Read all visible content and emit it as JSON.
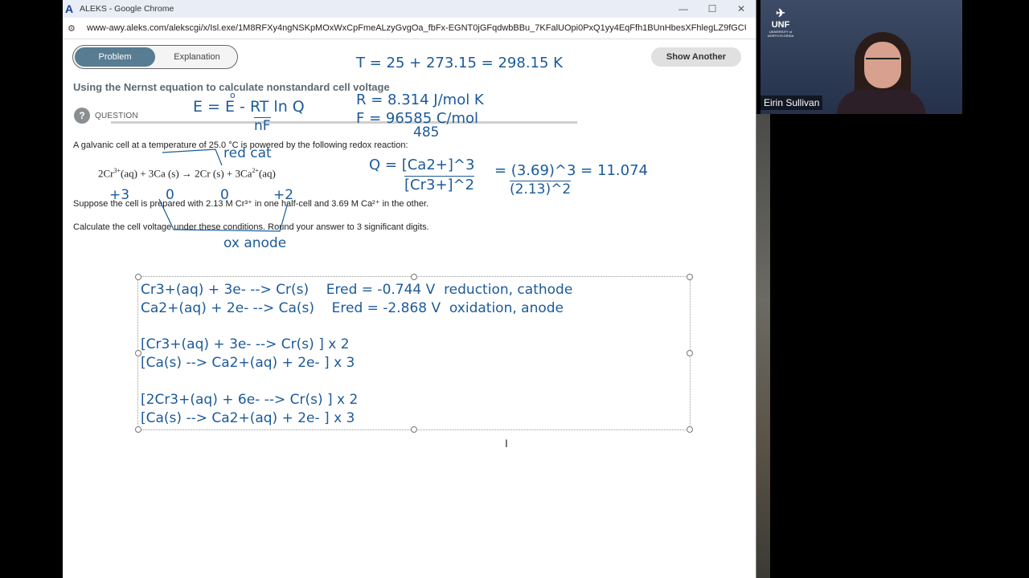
{
  "window": {
    "title": "ALEKS - Google Chrome",
    "url": "www-awy.aleks.com/alekscgi/x/Isl.exe/1M8RFXy4ngNSKpMOxWxCpFmeALzyGvgOa_fbFx-EGNT0jGFqdwbBBu_7KFalUOpi0PxQ1yy4EqFfh1BUnHbesXFhlegLZ9fGCUzCsl..."
  },
  "tabs": {
    "problem": "Problem",
    "explanation": "Explanation"
  },
  "show_another": "Show Another",
  "heading": "Using the Nernst equation to calculate nonstandard cell voltage",
  "question_label": "QUESTION",
  "problem": {
    "intro": "A galvanic cell at a temperature of 25.0 °C is powered by the following redox reaction:",
    "reaction": {
      "t1": "2Cr",
      "s1": "3+",
      "t2": "(aq) + 3Ca (s) → 2Cr (s) + 3Ca",
      "s2": "2+",
      "t3": "(aq)"
    },
    "suppose": "Suppose the cell is prepared with 2.13 M Cr³⁺ in one half-cell and 3.69 M Ca²⁺ in the other.",
    "calculate": "Calculate the cell voltage under these conditions. Round your answer to 3 significant digits."
  },
  "annotations": {
    "temp": "T = 25 + 273.15 = 298.15 K",
    "nernst_left": "E = E - RT ln Q",
    "nernst_nf": "nF",
    "deg": "o",
    "R": "R = 8.314 J/mol K",
    "F": "F = 96585 C/mol",
    "F_correction": "485",
    "red_cat": "red cat",
    "ox_anode": "ox anode",
    "q_num": "Q = [Ca2+]^3",
    "q_den": "[Cr3+]^2",
    "q_value": "= (3.69)^3 = 11.074",
    "q_value_den": "(2.13)^2",
    "ox_states": [
      "+3",
      "0",
      "0",
      "+2"
    ]
  },
  "notes": [
    "Cr3+(aq) + 3e- --> Cr(s)    Ered = -0.744 V  reduction, cathode",
    "Ca2+(aq) + 2e- --> Ca(s)    Ered = -2.868 V  oxidation, anode",
    "",
    "[Cr3+(aq) + 3e- --> Cr(s) ] x 2",
    "[Ca(s) --> Ca2+(aq) + 2e- ] x 3",
    "",
    "[2Cr3+(aq) + 6e- --> Cr(s) ] x 2",
    "[Ca(s) --> Ca2+(aq) + 2e- ] x 3"
  ],
  "video": {
    "participant": "Eirin Sullivan",
    "logo": "UNF",
    "logo_sub": "UNIVERSITY of NORTH FLORIDA"
  }
}
